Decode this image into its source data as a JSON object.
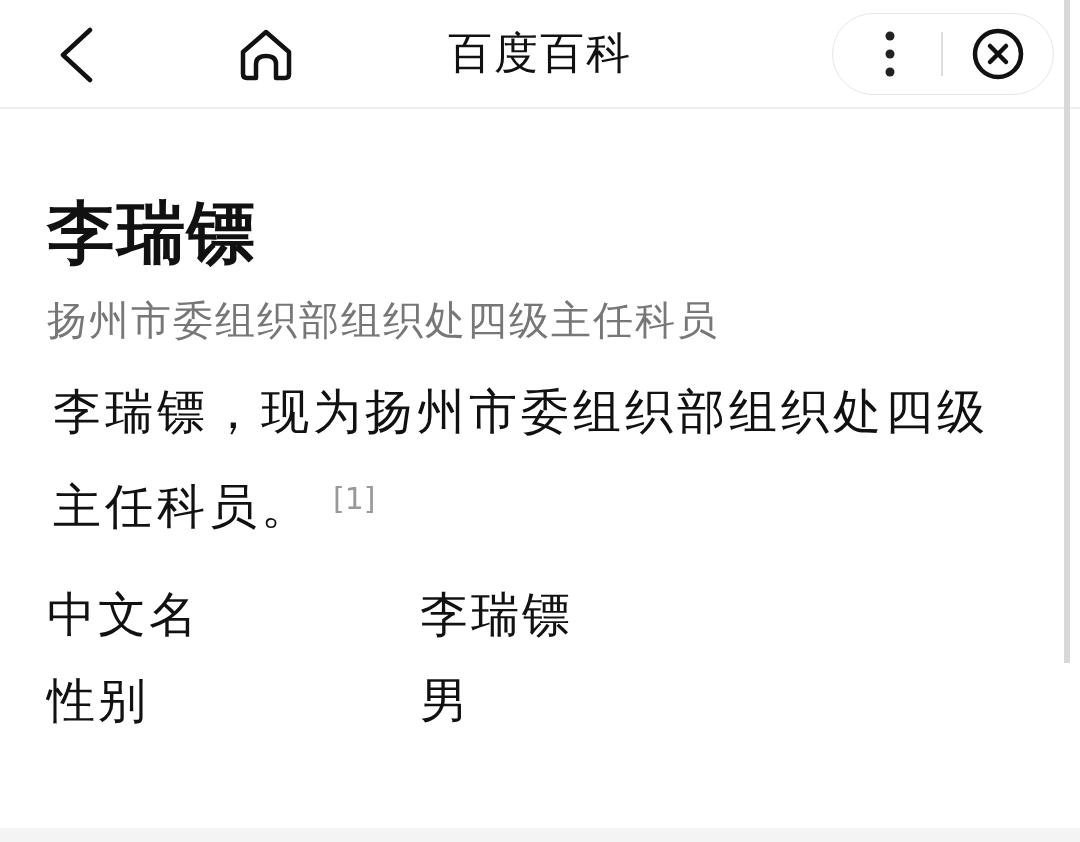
{
  "header": {
    "title": "百度百科"
  },
  "entry": {
    "title": "李瑞镖",
    "subtitle": "扬州市委组织部组织处四级主任科员",
    "summary": "李瑞镖，现为扬州市委组织部组织处四级主任科员。",
    "footnote": "[1]"
  },
  "info": [
    {
      "label": "中文名",
      "value": "李瑞镖"
    },
    {
      "label": "性别",
      "value": "男"
    }
  ]
}
